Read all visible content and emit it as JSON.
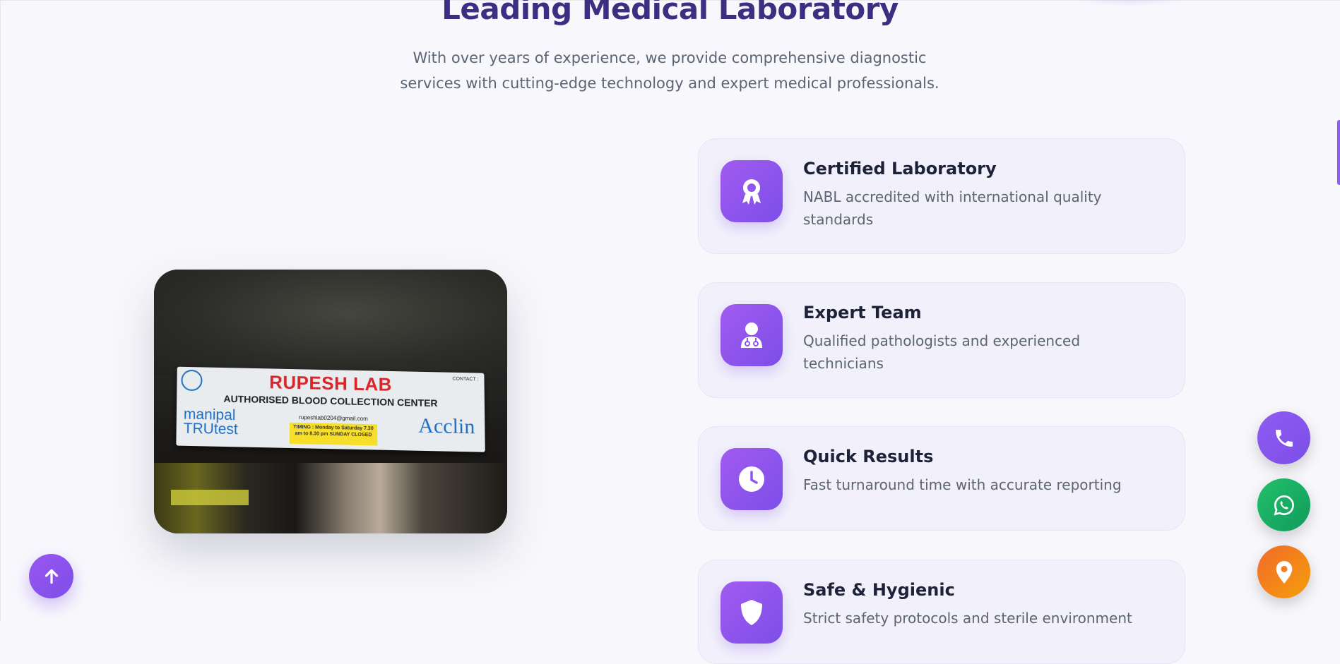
{
  "section": {
    "title": "Leading Medical Laboratory",
    "subtitle": "With over years of experience, we provide comprehensive diagnostic services with cutting-edge technology and expert medical professionals."
  },
  "photo": {
    "sign_title": "RUPESH LAB",
    "sign_subtitle": "AUTHORISED BLOOD COLLECTION CENTER",
    "sign_left_line1": "manipal",
    "sign_left_line2": "TRUtest",
    "sign_right": "Acclin",
    "sign_email": "rupeshlab0204@gmail.com",
    "sign_timing": "TIMING : Monday to Saturday 7.30 am to 8.30 pm SUNDAY CLOSED",
    "sign_contact": "CONTACT : "
  },
  "features": [
    {
      "icon": "award-icon",
      "title": "Certified Laboratory",
      "desc": "NABL accredited with international quality standards"
    },
    {
      "icon": "doctor-icon",
      "title": "Expert Team",
      "desc": "Qualified pathologists and experienced technicians"
    },
    {
      "icon": "clock-icon",
      "title": "Quick Results",
      "desc": "Fast turnaround time with accurate reporting"
    },
    {
      "icon": "shield-icon",
      "title": "Safe & Hygienic",
      "desc": "Strict safety protocols and sterile environment"
    }
  ],
  "floating_buttons": {
    "call_icon": "phone-icon",
    "whatsapp_icon": "whatsapp-icon",
    "location_icon": "map-pin-icon",
    "scroll_top_icon": "arrow-up-icon"
  },
  "colors": {
    "accent": "#7c4ee8",
    "title": "#3b2f82",
    "whatsapp": "#22c06a",
    "location": "#f26a2a"
  }
}
